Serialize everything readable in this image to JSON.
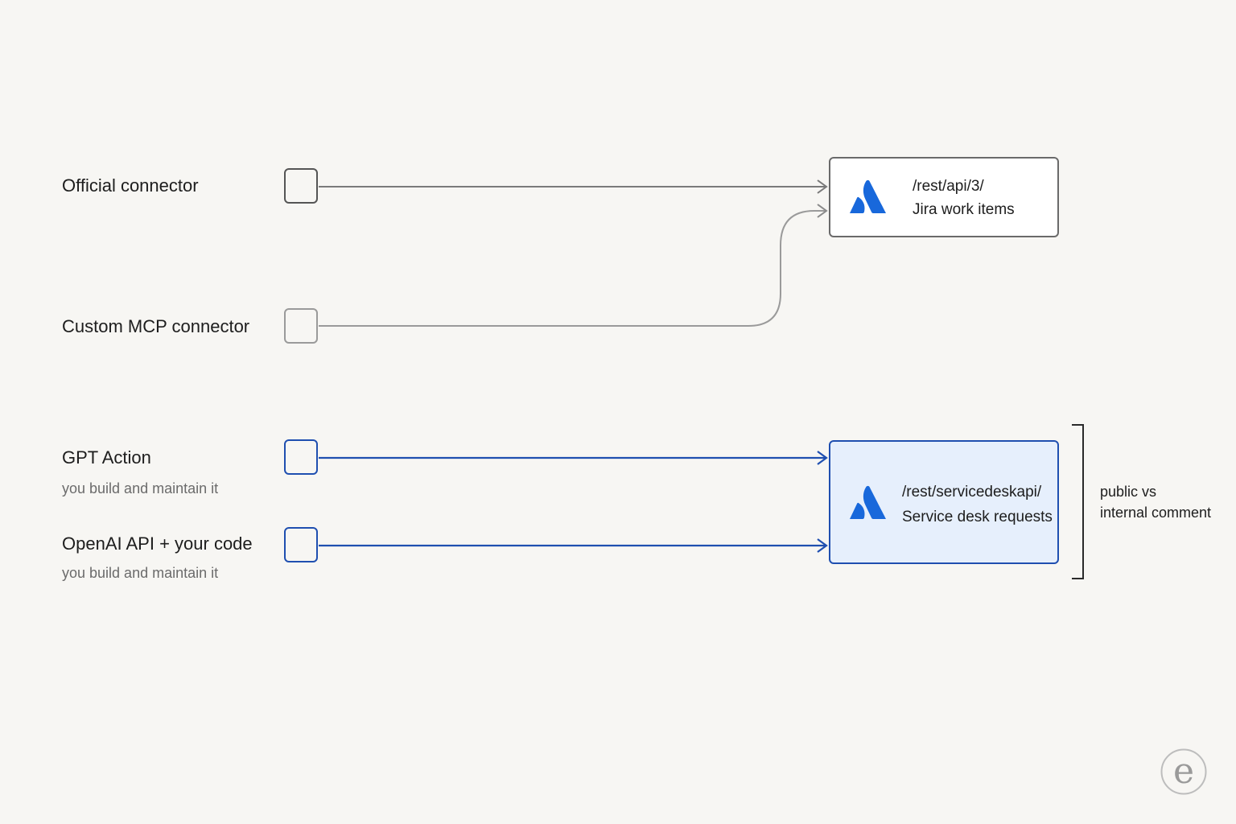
{
  "sources": [
    {
      "label": "Official connector",
      "sublabel": ""
    },
    {
      "label": "Custom MCP connector",
      "sublabel": ""
    },
    {
      "label": "GPT Action",
      "sublabel": "you build and maintain it"
    },
    {
      "label": "OpenAI API + your code",
      "sublabel": "you build and maintain it"
    }
  ],
  "targets": {
    "jira": {
      "endpoint": "/rest/api/3/",
      "description": "Jira work items",
      "logo_icon": "atlassian-logo-icon"
    },
    "service_desk": {
      "endpoint": "/rest/servicedeskapi/",
      "description": "Service desk requests",
      "logo_icon": "atlassian-logo-icon"
    }
  },
  "bracket_note": {
    "line1": "public vs",
    "line2": "internal comment"
  },
  "colors": {
    "background": "#f7f6f3",
    "official_wire": "#7a7a7a",
    "custom_wire": "#9a9a9a",
    "api_wire": "#1f4fb0",
    "atlassian_blue": "#1868db",
    "service_desk_fill": "#e6effc"
  },
  "watermark": {
    "letter": "e"
  }
}
